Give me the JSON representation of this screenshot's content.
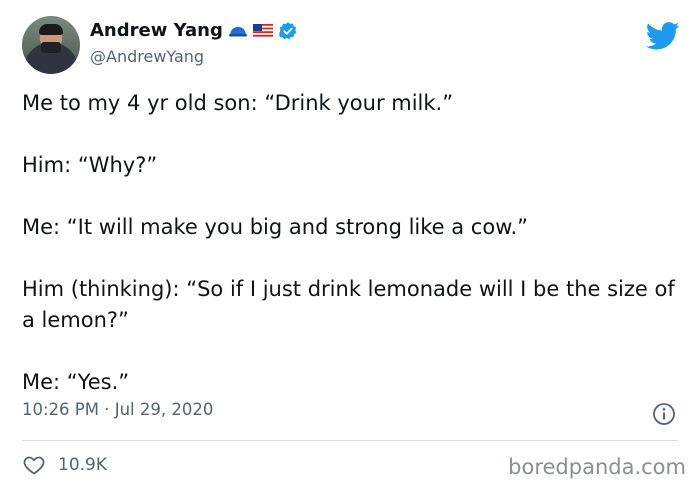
{
  "author": {
    "name": "Andrew Yang",
    "handle": "@AndrewYang",
    "badges": [
      "cap-emoji",
      "us-flag-emoji",
      "verified-badge-icon"
    ]
  },
  "brand_icon": "twitter-bird-icon",
  "tweet": {
    "lines": [
      "Me to my 4 yr old son:  “Drink your milk.”",
      "Him:  “Why?”",
      "Me:  “It will make you big and strong like a cow.”",
      "Him (thinking):  “So if I just drink lemonade will I be the size of a lemon?”",
      "Me:  “Yes.”"
    ],
    "timestamp": "10:26 PM · Jul 29, 2020",
    "likes": "10.9K"
  },
  "watermark": "boredpanda.com",
  "colors": {
    "twitter_blue": "#1d9bf0",
    "text": "#0f1419",
    "muted": "#536471"
  }
}
